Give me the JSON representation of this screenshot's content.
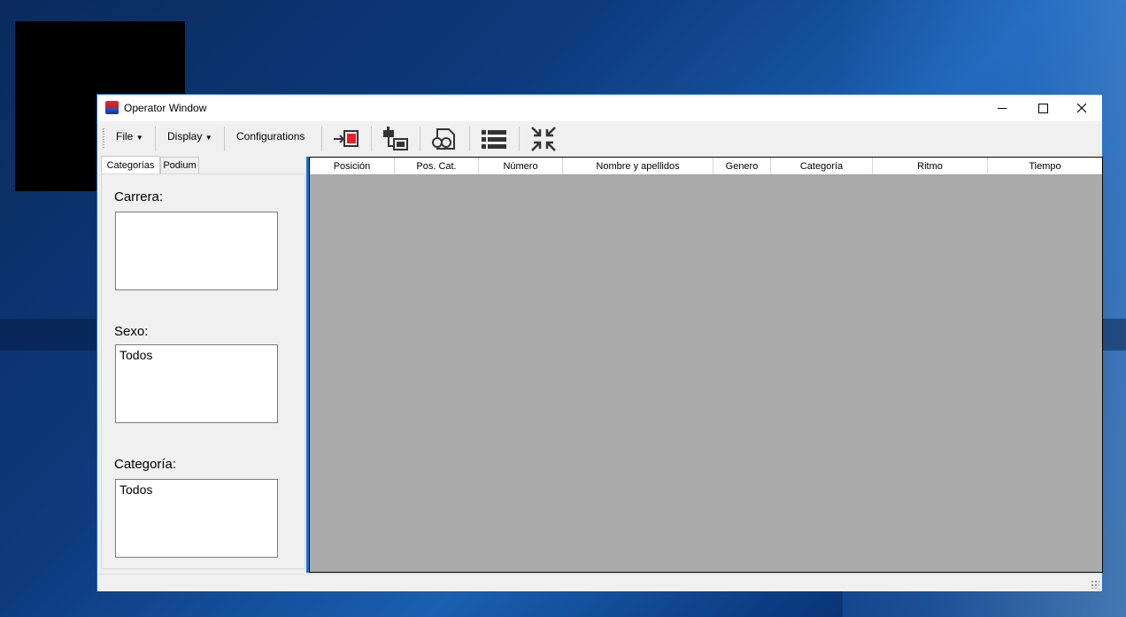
{
  "window": {
    "title": "Operator Window"
  },
  "toolbar": {
    "file_label": "File",
    "display_label": "Display",
    "configurations_label": "Configurations",
    "icons": [
      "import-stop-icon",
      "transfer-window-icon",
      "preview-document-icon",
      "list-icon",
      "collapse-arrows-icon"
    ]
  },
  "tabs": [
    {
      "label": "Categorías",
      "active": true
    },
    {
      "label": "Podium",
      "active": false
    }
  ],
  "filters": {
    "carrera": {
      "label": "Carrera:",
      "items": []
    },
    "sexo": {
      "label": "Sexo:",
      "items": [
        "Todos"
      ]
    },
    "categoria": {
      "label": "Categoría:",
      "items": [
        "Todos"
      ]
    }
  },
  "table": {
    "columns": [
      "Posición",
      "Pos. Cat.",
      "Número",
      "Nombre y apellidos",
      "Genero",
      "Categoría",
      "Ritmo",
      "Tiempo"
    ],
    "rows": []
  },
  "colors": {
    "accent": "#1c6fcf",
    "grid_background": "#ababab",
    "stop_red": "#e8202a"
  }
}
